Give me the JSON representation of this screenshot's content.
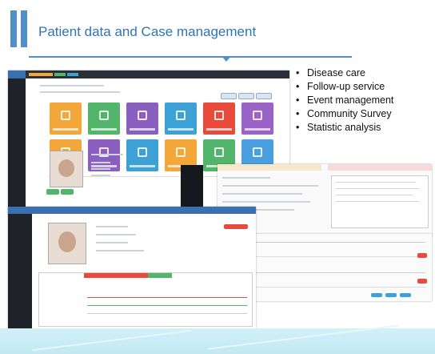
{
  "slide": {
    "title": "Patient data and Case management",
    "accent_color": "#4f90c8",
    "title_color": "#2f74b5"
  },
  "features": [
    "Disease care",
    "Follow-up service",
    "Event management",
    "Community Survey",
    "Statistic analysis"
  ],
  "bullet_glyph": "•",
  "tile_colors": [
    "#f3a63a",
    "#52b56b",
    "#8b5fbf",
    "#3da1d6",
    "#e84a3c",
    "#9b63c7",
    "#f3a63a",
    "#8b5fbf",
    "#3da1d6",
    "#f3a63a",
    "#52b56b",
    "#4aa0df"
  ]
}
